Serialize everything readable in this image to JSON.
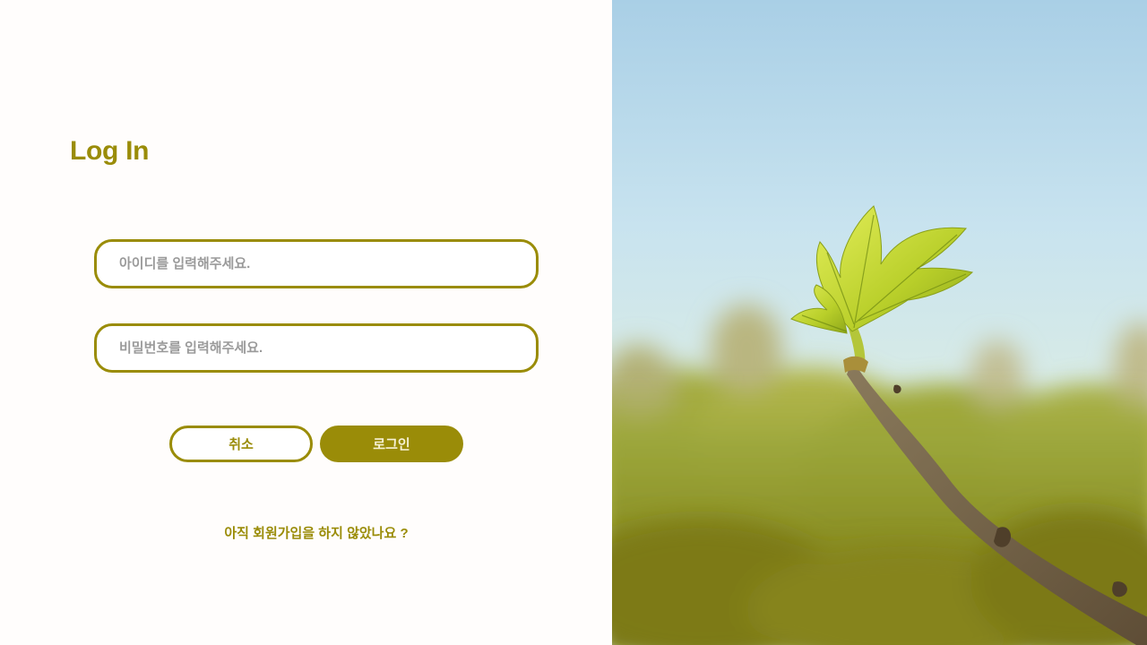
{
  "login": {
    "title": "Log In",
    "id_placeholder": "아이디를 입력해주세요.",
    "password_placeholder": "비밀번호를 입력해주세요.",
    "cancel_label": "취소",
    "login_label": "로그인",
    "signup_prompt": "아직 회원가입을 하지 않았나요 ?"
  },
  "theme": {
    "accent": "#9a8c08",
    "background": "#fffdfc"
  },
  "hero_image": {
    "subject": "fig-leaf-sprout-on-branch"
  }
}
